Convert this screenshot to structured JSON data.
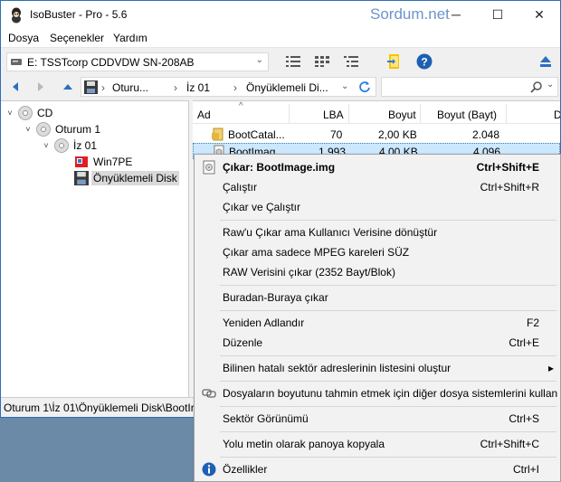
{
  "window": {
    "title": "IsoBuster - Pro - 5.6",
    "watermark": "Sordum.net",
    "controls": {
      "minimize": "─",
      "maximize": "☐",
      "close": "✕"
    }
  },
  "menubar": {
    "items": [
      "Dosya",
      "Seçenekler",
      "Yardım"
    ]
  },
  "drive": {
    "label": "E: TSSTcorp CDDVDW SN-208AB"
  },
  "path": {
    "segments": [
      "Oturu...",
      "İz 01",
      "Önyüklemeli Di..."
    ]
  },
  "tree": {
    "cd": "CD",
    "session": "Oturum 1",
    "track": "İz 01",
    "win7pe": "Win7PE",
    "boot_disk": "Önyüklemeli Disk"
  },
  "list": {
    "columns": [
      "Ad",
      "LBA",
      "Boyut",
      "Boyut (Bayt)",
      "D"
    ],
    "rows": [
      {
        "name": "BootCatal...",
        "lba": "70",
        "size": "2,00 KB",
        "bytes": "2.048"
      },
      {
        "name": "BootImag...",
        "lba": "1.993",
        "size": "4,00 KB",
        "bytes": "4.096"
      }
    ]
  },
  "status": {
    "path": "Oturum 1\\İz 01\\Önyüklemeli Disk\\BootIr"
  },
  "context_menu": {
    "items": [
      {
        "label": "Çıkar: BootImage.img",
        "shortcut": "Ctrl+Shift+E"
      },
      {
        "label": "Çalıştır",
        "shortcut": "Ctrl+Shift+R"
      },
      {
        "label": "Çıkar ve Çalıştır",
        "shortcut": ""
      },
      {
        "label": "Raw'u Çıkar ama Kullanıcı Verisine dönüştür",
        "shortcut": ""
      },
      {
        "label": "Çıkar ama sadece MPEG kareleri SÜZ",
        "shortcut": ""
      },
      {
        "label": "RAW Verisini çıkar (2352 Bayt/Blok)",
        "shortcut": ""
      },
      {
        "label": "Buradan-Buraya çıkar",
        "shortcut": ""
      },
      {
        "label": "Yeniden Adlandır",
        "shortcut": "F2"
      },
      {
        "label": "Düzenle",
        "shortcut": "Ctrl+E"
      },
      {
        "label": "Bilinen hatalı sektör adreslerinin listesini oluştur",
        "shortcut": ""
      },
      {
        "label": "Dosyaların boyutunu tahmin etmek için diğer dosya sistemlerini kullan",
        "shortcut": ""
      },
      {
        "label": "Sektör Görünümü",
        "shortcut": "Ctrl+S"
      },
      {
        "label": "Yolu metin olarak panoya kopyala",
        "shortcut": "Ctrl+Shift+C"
      },
      {
        "label": "Özellikler",
        "shortcut": "Ctrl+I"
      }
    ]
  },
  "colors": {
    "accent": "#1e73be",
    "selection": "#cce8ff",
    "watermark": "#6d95c8"
  }
}
